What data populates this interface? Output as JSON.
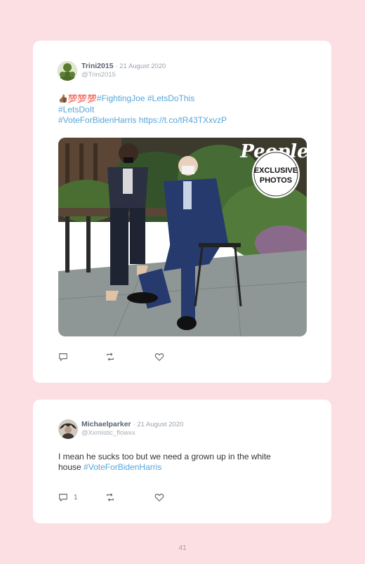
{
  "tweets": [
    {
      "name": "Trini2015",
      "date": "· 21 August 2020",
      "handle": "@Trini2015",
      "emoji": "👍🏾💯💯💯",
      "line1_tag1": "#FightingJoe",
      "line1_tag2": "#LetsDoThis",
      "line2": "#LetsDoIt",
      "line3_tag": "#VoteForBidenHarris",
      "line3_url": "https://t.co/tR43TXxvzP",
      "photo": {
        "brand": "People",
        "badge_line1": "EXCLUSIVE",
        "badge_line2": "PHOTOS"
      },
      "actions": {
        "reply_count": "",
        "retweet_count": "",
        "like_count": ""
      }
    },
    {
      "name": "Michaelparker",
      "date": "· 21 August 2020",
      "handle": "@Xxmistic_flowxx",
      "text_line1": "I mean he sucks too but we need a grown up in the white",
      "text_line2_plain": "house",
      "text_line2_tag": "#VoteForBidenHarris",
      "actions": {
        "reply_count": "1",
        "retweet_count": "",
        "like_count": ""
      }
    }
  ],
  "page_number": "41",
  "colors": {
    "background": "#fcdfe3",
    "link": "#57a6d9",
    "card": "#ffffff"
  }
}
